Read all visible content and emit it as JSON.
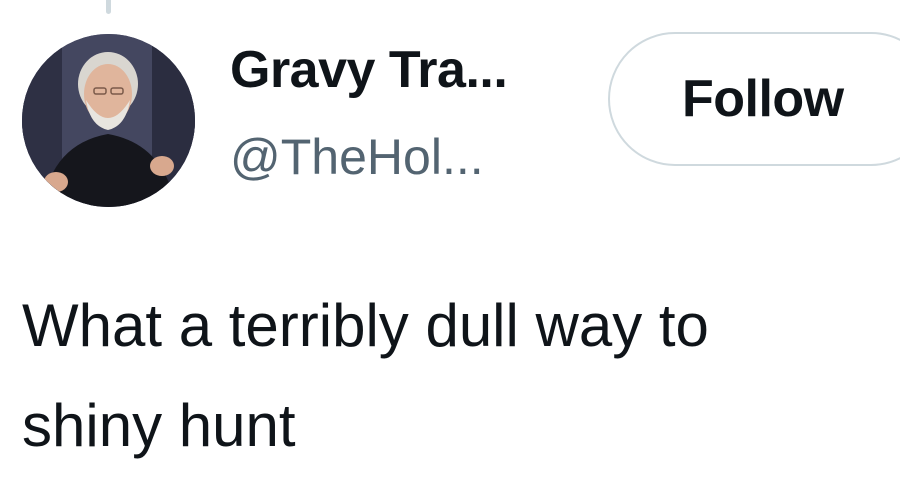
{
  "tweet": {
    "author": {
      "display_name": "Gravy Tra...",
      "handle": "@TheHol..."
    },
    "follow_label": "Follow",
    "text_line1": "What a terribly dull way to",
    "text_line2": "shiny hunt"
  },
  "colors": {
    "text_primary": "#0f1419",
    "text_secondary": "#536471",
    "border": "#cfd9de",
    "background": "#ffffff"
  }
}
